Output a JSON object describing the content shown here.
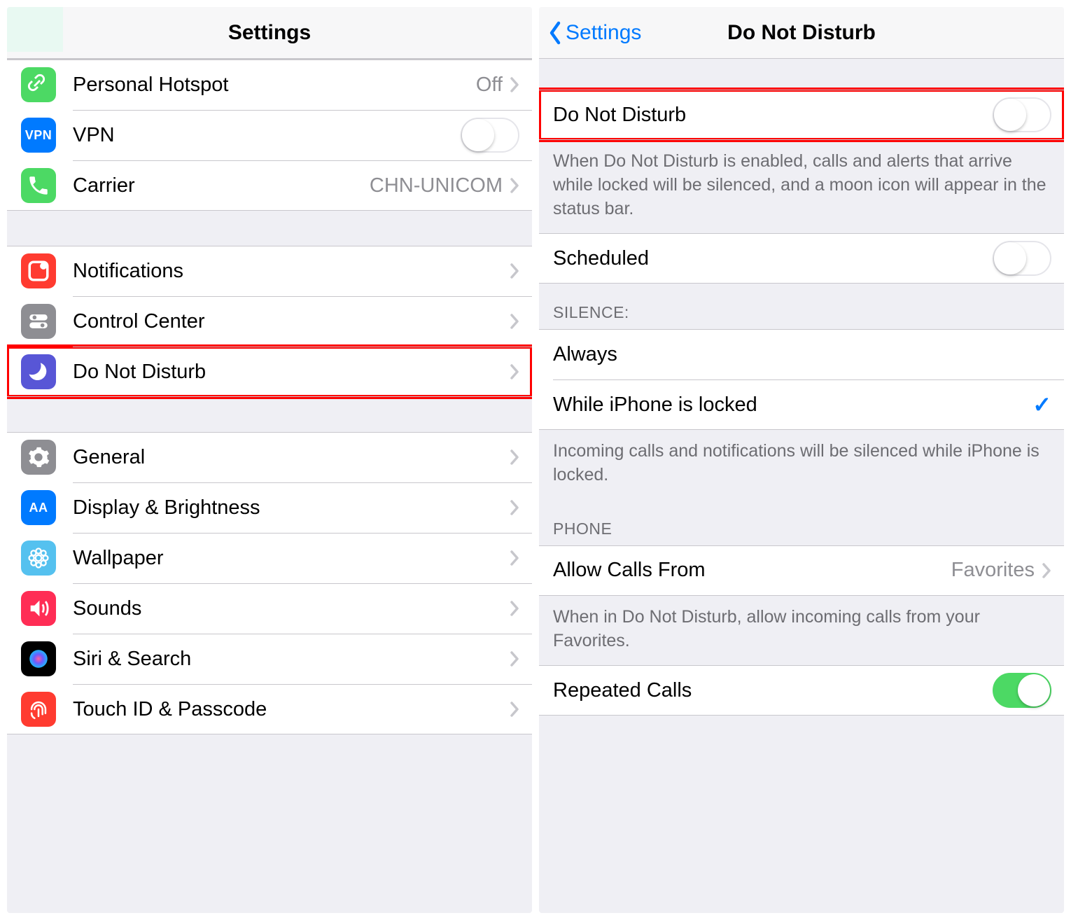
{
  "left": {
    "title": "Settings",
    "groups": [
      {
        "rows": [
          {
            "id": "personal-hotspot",
            "label": "Personal Hotspot",
            "value": "Off",
            "accessory": "disclosure",
            "icon": "link-icon",
            "icon_bg": "#4cd964"
          },
          {
            "id": "vpn",
            "label": "VPN",
            "accessory": "toggle",
            "toggle_on": false,
            "icon": "vpn-icon",
            "icon_bg": "#007aff",
            "icon_text": "VPN"
          },
          {
            "id": "carrier",
            "label": "Carrier",
            "value": "CHN-UNICOM",
            "accessory": "disclosure",
            "icon": "phone-icon",
            "icon_bg": "#4cd964"
          }
        ]
      },
      {
        "rows": [
          {
            "id": "notifications",
            "label": "Notifications",
            "accessory": "disclosure",
            "icon": "notifications-icon",
            "icon_bg": "#ff3b30"
          },
          {
            "id": "control-center",
            "label": "Control Center",
            "accessory": "disclosure",
            "icon": "control-center-icon",
            "icon_bg": "#8e8e93"
          },
          {
            "id": "do-not-disturb",
            "label": "Do Not Disturb",
            "accessory": "disclosure",
            "icon": "moon-icon",
            "icon_bg": "#5856d6",
            "highlight": true
          }
        ]
      },
      {
        "rows": [
          {
            "id": "general",
            "label": "General",
            "accessory": "disclosure",
            "icon": "gear-icon",
            "icon_bg": "#8e8e93"
          },
          {
            "id": "display-brightness",
            "label": "Display & Brightness",
            "accessory": "disclosure",
            "icon": "display-icon",
            "icon_bg": "#007aff",
            "icon_text": "AA"
          },
          {
            "id": "wallpaper",
            "label": "Wallpaper",
            "accessory": "disclosure",
            "icon": "wallpaper-icon",
            "icon_bg": "#55c1ef"
          },
          {
            "id": "sounds",
            "label": "Sounds",
            "accessory": "disclosure",
            "icon": "sounds-icon",
            "icon_bg": "#ff2d55"
          },
          {
            "id": "siri-search",
            "label": "Siri & Search",
            "accessory": "disclosure",
            "icon": "siri-icon",
            "icon_bg": "#000"
          },
          {
            "id": "touchid-passcode",
            "label": "Touch ID & Passcode",
            "accessory": "disclosure",
            "icon": "fingerprint-icon",
            "icon_bg": "#ff3b30"
          }
        ]
      }
    ]
  },
  "right": {
    "back_label": "Settings",
    "title": "Do Not Disturb",
    "sections": [
      {
        "rows": [
          {
            "id": "dnd-master",
            "label": "Do Not Disturb",
            "accessory": "toggle",
            "toggle_on": false,
            "highlight": true
          }
        ],
        "footer": "When Do Not Disturb is enabled, calls and alerts that arrive while locked will be silenced, and a moon icon will appear in the status bar."
      },
      {
        "rows": [
          {
            "id": "scheduled",
            "label": "Scheduled",
            "accessory": "toggle",
            "toggle_on": false
          }
        ]
      },
      {
        "header": "SILENCE:",
        "rows": [
          {
            "id": "silence-always",
            "label": "Always",
            "accessory": "none"
          },
          {
            "id": "silence-locked",
            "label": "While iPhone is locked",
            "accessory": "check"
          }
        ],
        "footer": "Incoming calls and notifications will be silenced while iPhone is locked."
      },
      {
        "header": "PHONE",
        "rows": [
          {
            "id": "allow-calls-from",
            "label": "Allow Calls From",
            "value": "Favorites",
            "accessory": "disclosure"
          }
        ],
        "footer": "When in Do Not Disturb, allow incoming calls from your Favorites."
      },
      {
        "rows": [
          {
            "id": "repeated-calls",
            "label": "Repeated Calls",
            "accessory": "toggle",
            "toggle_on": true
          }
        ]
      }
    ]
  }
}
